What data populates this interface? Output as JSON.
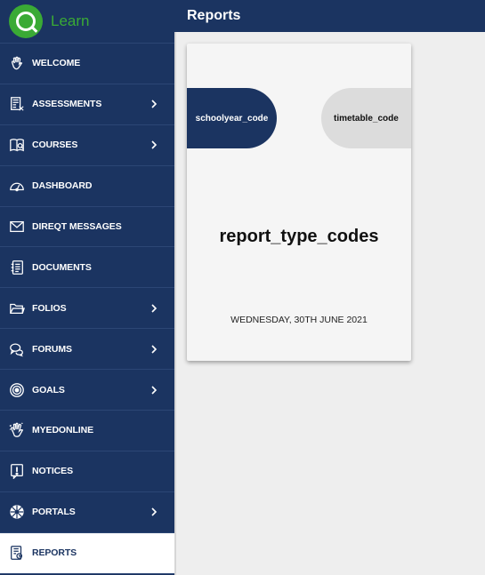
{
  "logo": {
    "text": "Learn"
  },
  "header": {
    "title": "Reports"
  },
  "sidebar": {
    "items": [
      {
        "label": "WELCOME",
        "icon": "wave-hand-icon",
        "has_submenu": false
      },
      {
        "label": "ASSESSMENTS",
        "icon": "assessment-icon",
        "has_submenu": true
      },
      {
        "label": "COURSES",
        "icon": "book-icon",
        "has_submenu": true
      },
      {
        "label": "DASHBOARD",
        "icon": "gauge-icon",
        "has_submenu": false
      },
      {
        "label": "DIREQT MESSAGES",
        "icon": "envelope-icon",
        "has_submenu": false
      },
      {
        "label": "DOCUMENTS",
        "icon": "document-icon",
        "has_submenu": false
      },
      {
        "label": "FOLIOS",
        "icon": "folder-icon",
        "has_submenu": true
      },
      {
        "label": "FORUMS",
        "icon": "chat-bubbles-icon",
        "has_submenu": true
      },
      {
        "label": "GOALS",
        "icon": "target-icon",
        "has_submenu": true
      },
      {
        "label": "MYEDONLINE",
        "icon": "hand-icon",
        "has_submenu": false
      },
      {
        "label": "NOTICES",
        "icon": "notice-icon",
        "has_submenu": false
      },
      {
        "label": "PORTALS",
        "icon": "portal-icon",
        "has_submenu": true
      },
      {
        "label": "REPORTS",
        "icon": "report-icon",
        "has_submenu": false,
        "active": true
      }
    ]
  },
  "card": {
    "left_tag": "schoolyear_code",
    "right_tag": "timetable_code",
    "title": "report_type_codes",
    "date": "WEDNESDAY, 30TH JUNE 2021"
  },
  "colors": {
    "navy": "#1b3461",
    "brand_green": "#3aaa35",
    "background": "#eeeeee",
    "card": "#f5f5f5"
  }
}
